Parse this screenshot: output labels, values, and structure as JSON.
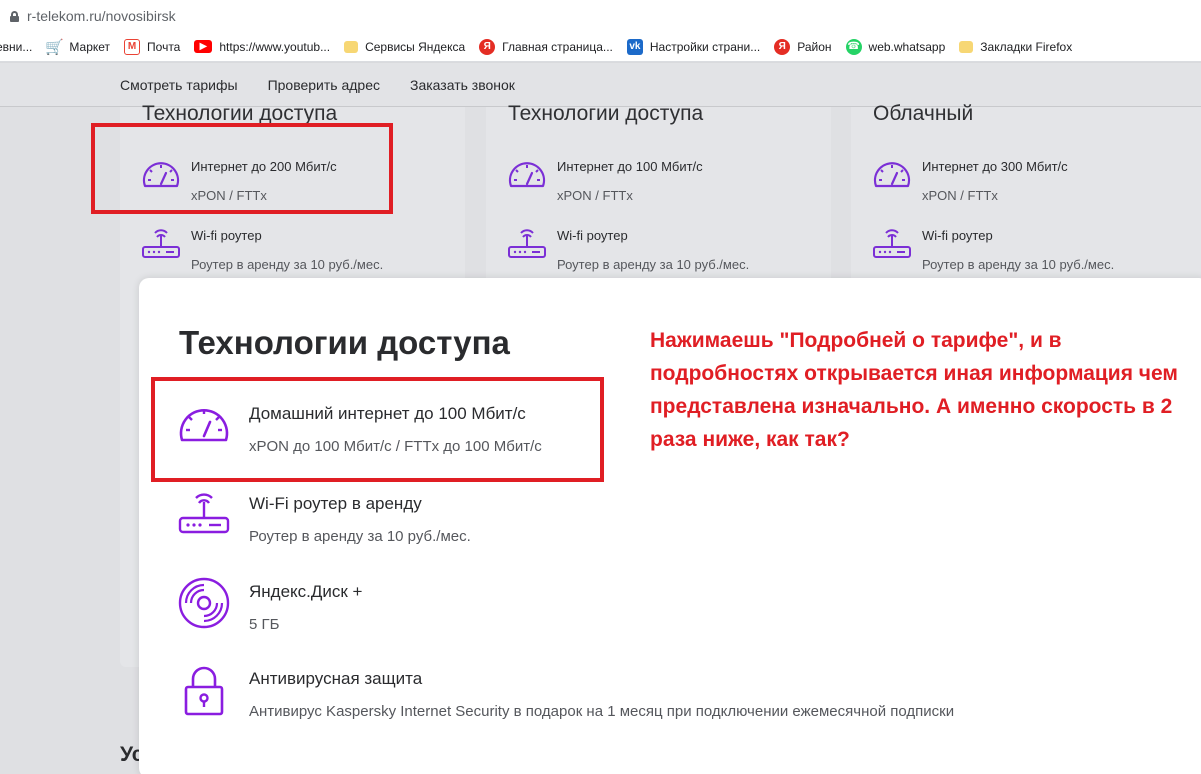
{
  "browser": {
    "url": "r-telekom.ru/novosibirsk",
    "bookmarks": [
      {
        "label": "евни...",
        "icon": "none"
      },
      {
        "label": "Маркет",
        "icon": "cart-icon"
      },
      {
        "label": "Почта",
        "icon": "gmail-icon"
      },
      {
        "label": "https://www.youtub...",
        "icon": "youtube-icon"
      },
      {
        "label": "Сервисы Яндекса",
        "icon": "folder-icon"
      },
      {
        "label": "Главная страница...",
        "icon": "yandex-icon"
      },
      {
        "label": "Настройки страни...",
        "icon": "vk-icon"
      },
      {
        "label": "Район",
        "icon": "yandex-icon"
      },
      {
        "label": "web.whatsapp",
        "icon": "whatsapp-icon"
      },
      {
        "label": "Закладки Firefox",
        "icon": "folder-icon"
      }
    ]
  },
  "site_nav": {
    "items": [
      "Смотреть тарифы",
      "Проверить адрес",
      "Заказать звонок"
    ]
  },
  "cards": [
    {
      "title": "Технологии доступа",
      "speed_label": "Интернет до 200 Мбит/с",
      "speed_tech": "xPON / FTTx",
      "router_label": "Wi-fi роутер",
      "router_rent": "Роутер в аренду за 10 руб./мес."
    },
    {
      "title": "Технологии доступа",
      "speed_label": "Интернет до 100 Мбит/с",
      "speed_tech": "xPON / FTTx",
      "router_label": "Wi-fi роутер",
      "router_rent": "Роутер в аренду за 10 руб./мес."
    },
    {
      "title": "Облачный",
      "speed_label": "Интернет до 300 Мбит/с",
      "speed_tech": "xPON / FTTx",
      "router_label": "Wi-fi роутер",
      "router_rent": "Роутер в аренду за 10 руб./мес."
    }
  ],
  "page_partial_text": "Ус",
  "modal": {
    "title": "Технологии доступа",
    "items": [
      {
        "title": "Домашний интернет до 100 Мбит/с",
        "desc": "xPON до 100 Мбит/с / FTTx до 100 Мбит/с"
      },
      {
        "title": "Wi-Fi роутер в аренду",
        "desc": "Роутер в аренду за 10 руб./мес."
      },
      {
        "title": "Яндекс.Диск +",
        "desc": "5 ГБ"
      },
      {
        "title": "Антивирусная защита",
        "desc": "Антивирус Kaspersky Internet Security в подарок на 1 месяц при подключении ежемесячной подписки"
      }
    ]
  },
  "annotation": "Нажимаешь \"Подробней о тарифе\", и в подробностях открывается иная информация чем представлена изначально. А именно скорость в 2 раза ниже, как так?",
  "colors": {
    "accent_purple": "#8a1de0",
    "annotation_red": "#e01e24"
  }
}
